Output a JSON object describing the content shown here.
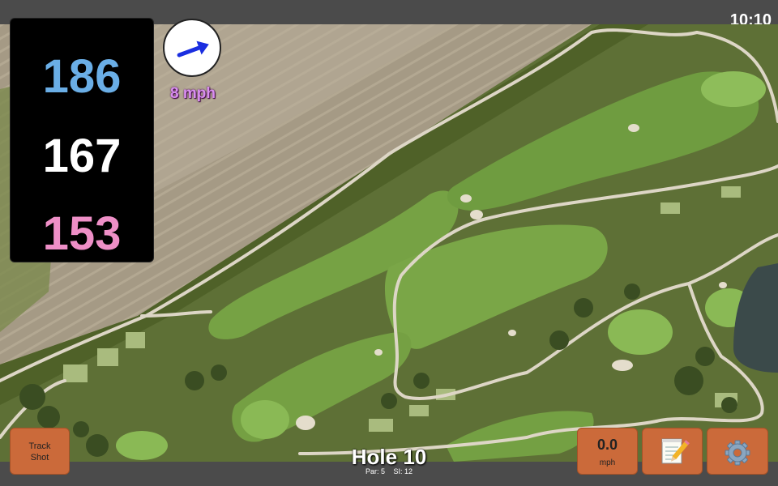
{
  "status": {
    "time": "10:10"
  },
  "yardages": {
    "back": "186",
    "middle": "167",
    "front": "153"
  },
  "wind": {
    "speed": "8 mph",
    "icon": "wind-arrow-icon",
    "arrow_color": "#1a2ee0"
  },
  "buttons": {
    "track_shot": {
      "line1": "Track",
      "line2": "Shot"
    },
    "speed": {
      "value": "0.0",
      "unit": "mph"
    },
    "notes_icon": "notepad-icon",
    "settings_icon": "gear-icon"
  },
  "hole": {
    "title": "Hole 10",
    "par": "Par: 5",
    "si": "SI: 12"
  },
  "colors": {
    "button": "#cb6a3a",
    "back_yardage": "#6aaee6",
    "front_yardage": "#ee8fc7",
    "wind_text": "#d98ff0"
  }
}
